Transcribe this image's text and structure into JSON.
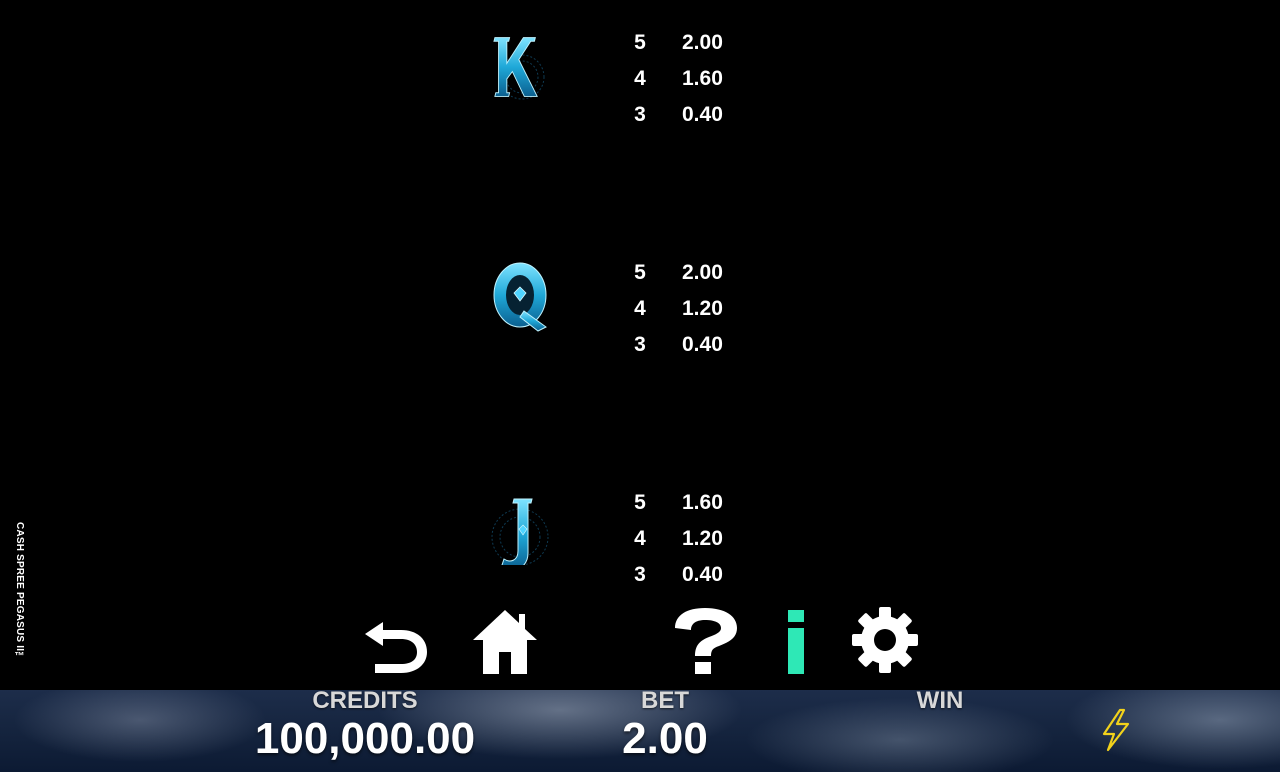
{
  "game_title": "CASH SPREE PEGASUS II™",
  "paytable": [
    {
      "symbol": "K",
      "icon": "k-symbol-icon",
      "payouts": [
        {
          "count": "5",
          "value": "2.00"
        },
        {
          "count": "4",
          "value": "1.60"
        },
        {
          "count": "3",
          "value": "0.40"
        }
      ]
    },
    {
      "symbol": "Q",
      "icon": "q-symbol-icon",
      "payouts": [
        {
          "count": "5",
          "value": "2.00"
        },
        {
          "count": "4",
          "value": "1.20"
        },
        {
          "count": "3",
          "value": "0.40"
        }
      ]
    },
    {
      "symbol": "J",
      "icon": "j-symbol-icon",
      "payouts": [
        {
          "count": "5",
          "value": "1.60"
        },
        {
          "count": "4",
          "value": "1.20"
        },
        {
          "count": "3",
          "value": "0.40"
        }
      ]
    }
  ],
  "toolbar": {
    "back_icon": "back-arrow-icon",
    "home_icon": "home-icon",
    "help_icon": "question-mark-icon",
    "info_icon": "info-icon",
    "settings_icon": "gear-icon"
  },
  "info_bar": {
    "credits_label": "CREDITS",
    "credits_value": "100,000.00",
    "bet_label": "BET",
    "bet_value": "2.00",
    "win_label": "WIN",
    "win_value": "",
    "turbo_icon": "lightning-bolt-icon"
  },
  "colors": {
    "background": "#000000",
    "info_active": "#2ee8b6",
    "symbol_blue": "#2bb4e0",
    "lightning": "#f2d21b"
  }
}
